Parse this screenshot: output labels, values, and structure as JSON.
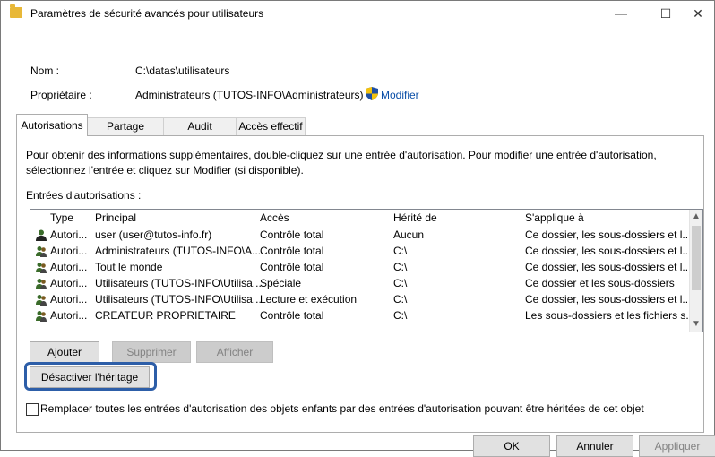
{
  "window": {
    "title": "Paramètres de sécurité avancés pour utilisateurs",
    "min_symbol": "—",
    "max_symbol": "☐",
    "close_symbol": "✕"
  },
  "info": {
    "name_label": "Nom :",
    "name_value": "C:\\datas\\utilisateurs",
    "owner_label": "Propriétaire :",
    "owner_value": "Administrateurs (TUTOS-INFO\\Administrateurs)",
    "modify_link": "Modifier"
  },
  "tabs": [
    {
      "label": "Autorisations"
    },
    {
      "label": "Partage"
    },
    {
      "label": "Audit"
    },
    {
      "label": "Accès effectif"
    }
  ],
  "instructions": {
    "line1": "Pour obtenir des informations supplémentaires, double-cliquez sur une entrée d'autorisation. Pour modifier une entrée d'autorisation,",
    "line2": "sélectionnez l'entrée et cliquez sur Modifier (si disponible)."
  },
  "entries_label": "Entrées d'autorisations :",
  "columns": [
    "Type",
    "Principal",
    "Accès",
    "Hérité de",
    "S'applique à"
  ],
  "rows": [
    {
      "icon": "user-icon",
      "type": "Autori...",
      "principal": "user (user@tutos-info.fr)",
      "access": "Contrôle total",
      "inherited": "Aucun",
      "applies": "Ce dossier, les sous-dossiers et l..."
    },
    {
      "icon": "group-icon",
      "type": "Autori...",
      "principal": "Administrateurs (TUTOS-INFO\\A...",
      "access": "Contrôle total",
      "inherited": "C:\\",
      "applies": "Ce dossier, les sous-dossiers et l..."
    },
    {
      "icon": "group-icon",
      "type": "Autori...",
      "principal": "Tout le monde",
      "access": "Contrôle total",
      "inherited": "C:\\",
      "applies": "Ce dossier, les sous-dossiers et l..."
    },
    {
      "icon": "group-icon",
      "type": "Autori...",
      "principal": "Utilisateurs (TUTOS-INFO\\Utilisa...",
      "access": "Spéciale",
      "inherited": "C:\\",
      "applies": "Ce dossier et les sous-dossiers"
    },
    {
      "icon": "group-icon",
      "type": "Autori...",
      "principal": "Utilisateurs (TUTOS-INFO\\Utilisa...",
      "access": "Lecture et exécution",
      "inherited": "C:\\",
      "applies": "Ce dossier, les sous-dossiers et l..."
    },
    {
      "icon": "group-icon",
      "type": "Autori...",
      "principal": "CREATEUR PROPRIETAIRE",
      "access": "Contrôle total",
      "inherited": "C:\\",
      "applies": "Les sous-dossiers et les fichiers s..."
    }
  ],
  "buttons": {
    "add": "Ajouter",
    "remove": "Supprimer",
    "view": "Afficher",
    "disable_inheritance": "Désactiver l'héritage",
    "ok": "OK",
    "cancel": "Annuler",
    "apply": "Appliquer"
  },
  "replace_checkbox_label": "Remplacer toutes les entrées d'autorisation des objets enfants par des entrées d'autorisation pouvant être héritées de cet objet",
  "colors": {
    "highlight": "#2d5ea8",
    "folder": "#e8b838"
  }
}
